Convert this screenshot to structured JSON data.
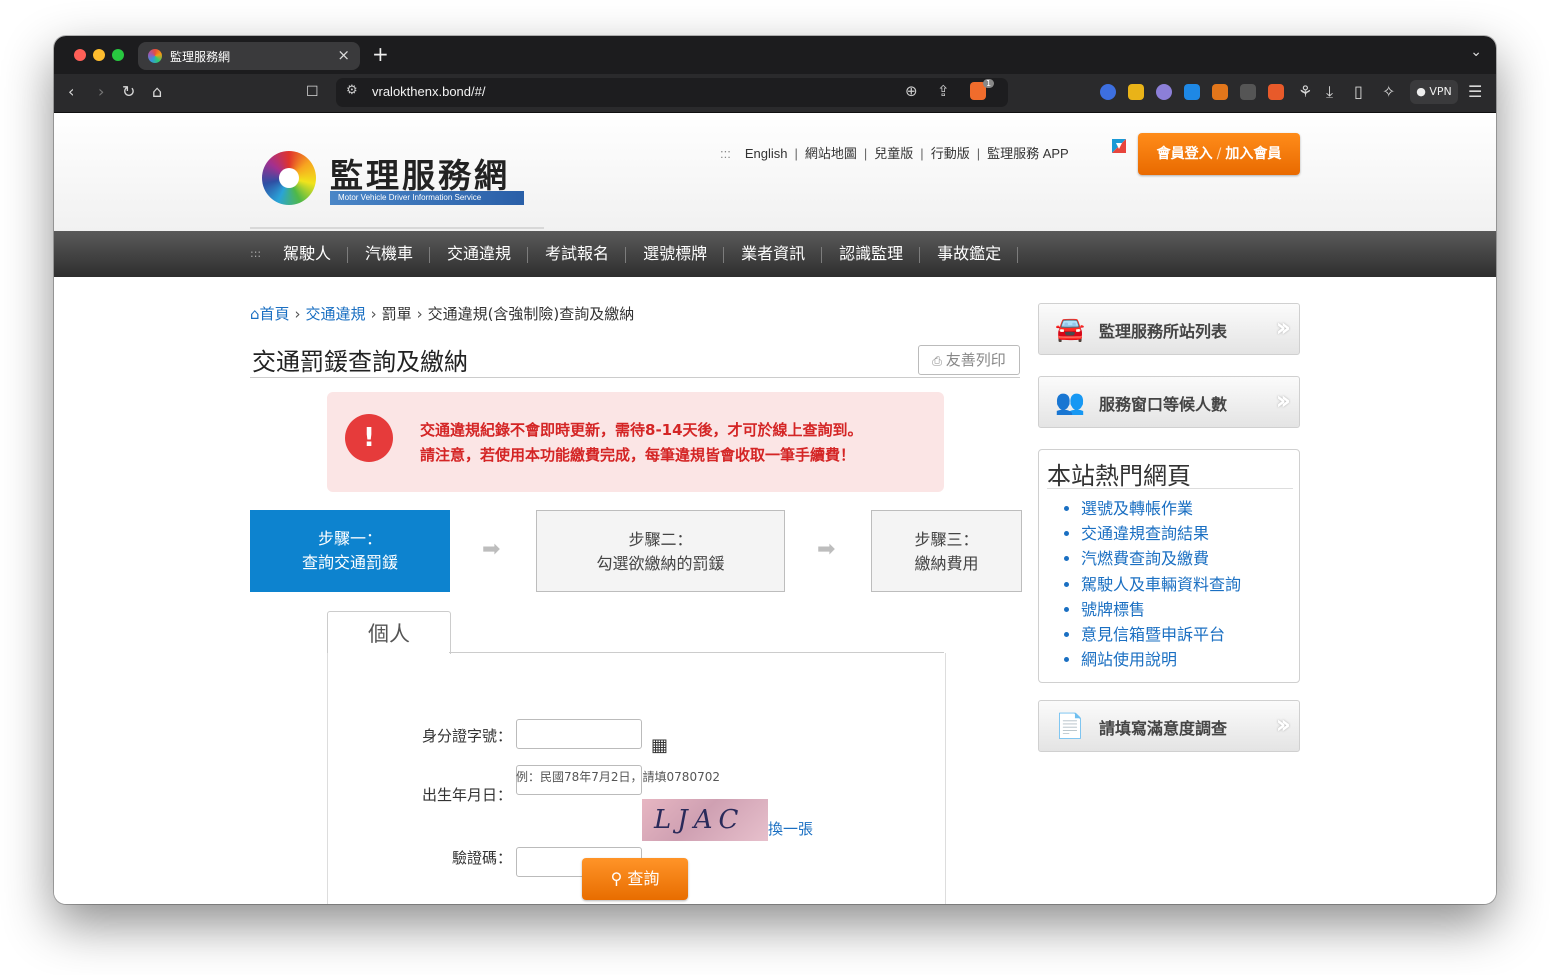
{
  "browser": {
    "tab_title": "監理服務網",
    "tab_close": "×",
    "new_tab": "+",
    "url": "vralokthenx.bond/#/",
    "vpn_label": "VPN",
    "shield_badge": "1"
  },
  "header": {
    "logo_title": "監理服務網",
    "logo_subtitle": "Motor Vehicle Driver Information Service",
    "top_lead": ":::",
    "top_links": [
      "English",
      "網站地圖",
      "兒童版",
      "行動版",
      "監理服務 APP"
    ],
    "login_label": "會員登入",
    "join_label": "加入會員",
    "login_slash": "/"
  },
  "nav": {
    "lead": ":::",
    "items": [
      "駕駛人",
      "汽機車",
      "交通違規",
      "考試報名",
      "選號標牌",
      "業者資訊",
      "認識監理",
      "事故鑑定"
    ]
  },
  "breadcrumb": {
    "home": "首頁",
    "sep": "›",
    "level1": "交通違規",
    "level2": "罰單",
    "level3": "交通違規(含強制險)查詢及繳納"
  },
  "page": {
    "title": "交通罰鍰查詢及繳納",
    "print_label": "友善列印"
  },
  "alert": {
    "icon": "!",
    "line1": "交通違規紀錄不會即時更新，需待8-14天後，才可於線上查詢到。",
    "line2": "請注意，若使用本功能繳費完成，每筆違規皆會收取一筆手續費！"
  },
  "steps": [
    {
      "line1": "步驟一：",
      "line2": "查詢交通罰鍰"
    },
    {
      "line1": "步驟二：",
      "line2": "勾選欲繳納的罰鍰"
    },
    {
      "line1": "步驟三：",
      "line2": "繳納費用"
    }
  ],
  "step_arrow": "➡",
  "form": {
    "tab_label": "個人",
    "id_label": "身分證字號：",
    "birth_label": "出生年月日：",
    "birth_hint": "例：民國78年7月2日，請填0780702",
    "captcha_label": "驗證碼：",
    "captcha_text": "LJAC",
    "refresh_label": "換一張",
    "query_label": "查詢"
  },
  "sidebar": {
    "station_list": "監理服務所站列表",
    "queue_count": "服務窗口等候人數",
    "hot_title": "本站熱門網頁",
    "hot_links": [
      "選號及轉帳作業",
      "交通違規查詢結果",
      "汽燃費查詢及繳費",
      "駕駛人及車輛資料查詢",
      "號牌標售",
      "意見信箱暨申訴平台",
      "網站使用說明"
    ],
    "survey": "請填寫滿意度調查"
  },
  "colors": {
    "accent_blue": "#0d83cf",
    "link_blue": "#1a6fc2",
    "orange": "#e96a00",
    "alert_red": "#d42525"
  }
}
